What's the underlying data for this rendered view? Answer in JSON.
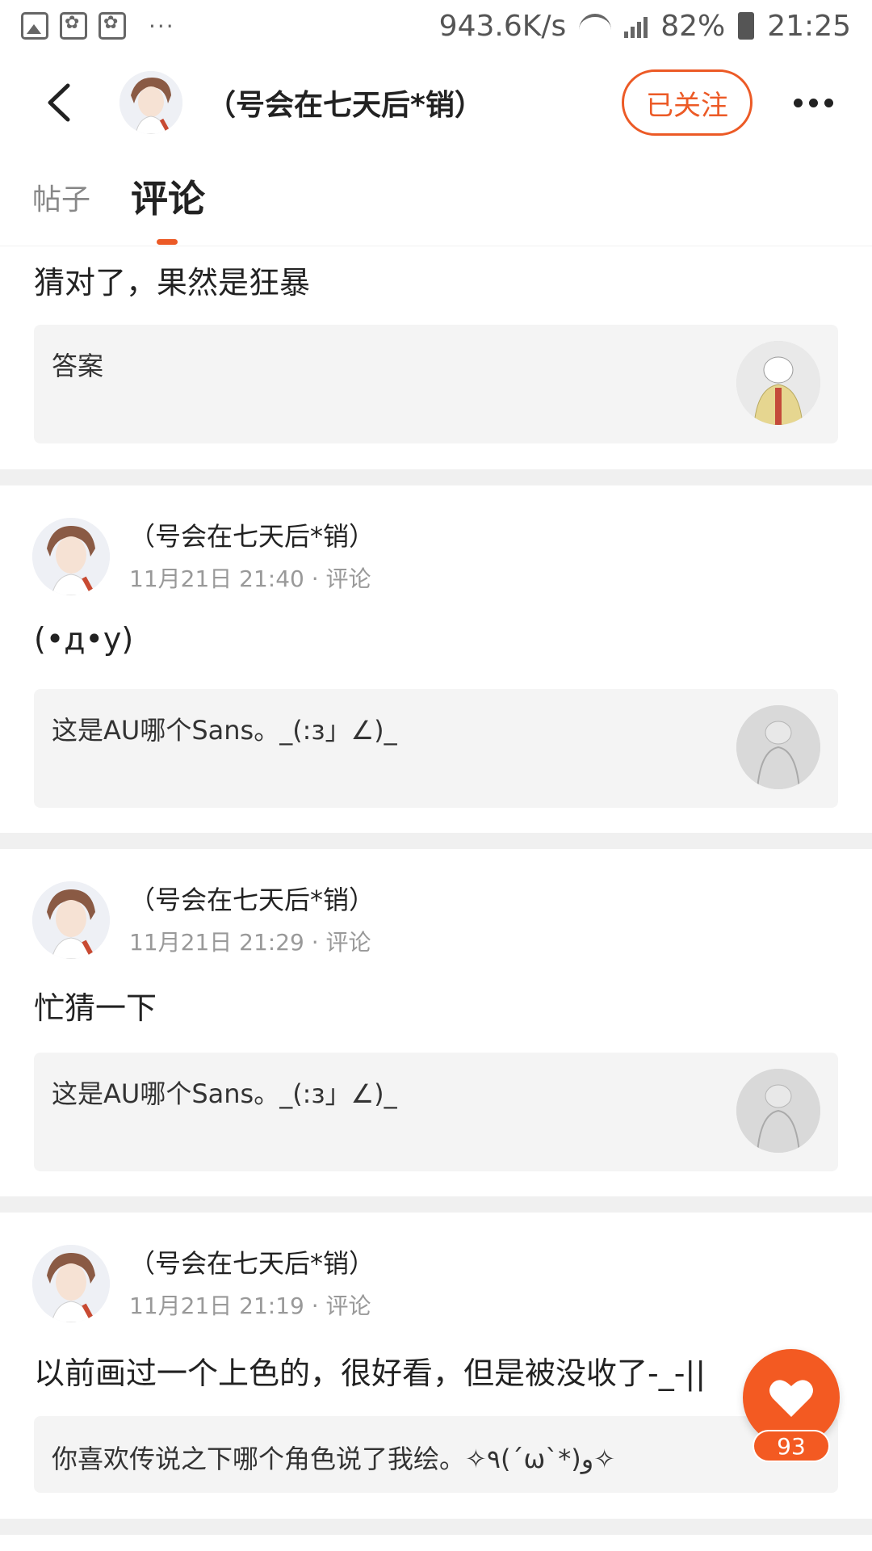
{
  "status_bar": {
    "net_speed": "943.6K/s",
    "battery": "82%",
    "time": "21:25",
    "left_icons": [
      "image-icon",
      "paw-icon",
      "paw-icon"
    ],
    "more": "···"
  },
  "header": {
    "title": "（号会在七天后*销）",
    "follow_label": "已关注",
    "accent": "#ec5a26"
  },
  "tabs": [
    {
      "label": "帖子",
      "active": false
    },
    {
      "label": "评论",
      "active": true
    }
  ],
  "feed": {
    "items": [
      {
        "text": "猜对了，果然是狂暴",
        "quote": "答案"
      },
      {
        "author": "（号会在七天后*销）",
        "meta": "11月21日 21:40 · 评论",
        "text": "(•д•y)",
        "quote": "这是AU哪个Sans。_(:з」∠)_"
      },
      {
        "author": "（号会在七天后*销）",
        "meta": "11月21日 21:29 · 评论",
        "text": "忙猜一下",
        "quote": "这是AU哪个Sans。_(:з」∠)_"
      },
      {
        "author": "（号会在七天后*销）",
        "meta": "11月21日 21:19 · 评论",
        "text": "以前画过一个上色的，很好看，但是被没收了-_-||",
        "quote": "你喜欢传说之下哪个角色说了我绘。✧٩(ˊωˋ*)و✧"
      }
    ]
  },
  "like": {
    "count": "93",
    "color": "#f35a22"
  }
}
